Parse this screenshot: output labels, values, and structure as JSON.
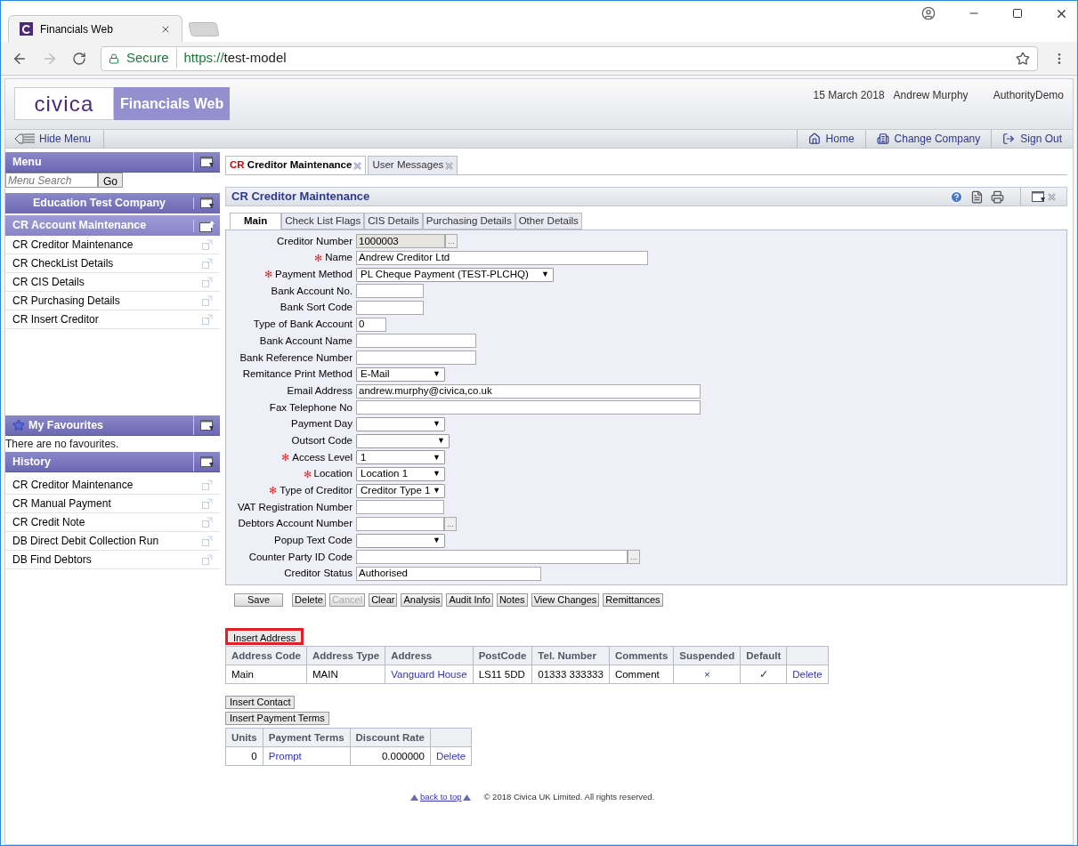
{
  "browser": {
    "tab_title": "Financials Web",
    "security": "Secure",
    "url_scheme": "https://",
    "url_host": "test-model"
  },
  "header": {
    "logo": "civica",
    "product": "Financials Web",
    "date": "15 March 2018",
    "user": "Andrew Murphy",
    "authority": "AuthorityDemo"
  },
  "menu_bar": {
    "hide_menu": "Hide Menu",
    "links": [
      "Home",
      "Change Company",
      "Sign Out"
    ]
  },
  "sidebar": {
    "menu_title": "Menu",
    "search_placeholder": "Menu Search",
    "go": "Go",
    "company": "Education Test Company",
    "section": "CR Account Maintenance",
    "items": [
      "CR Creditor Maintenance",
      "CR CheckList Details",
      "CR CIS Details",
      "CR Purchasing Details",
      "CR Insert Creditor"
    ],
    "favourites_title": "My Favourites",
    "favourites_empty": "There are no favourites.",
    "history_title": "History",
    "history": [
      "CR Creditor Maintenance",
      "CR Manual Payment",
      "CR Credit Note",
      "DB Direct Debit Collection Run",
      "DB Find Debtors"
    ]
  },
  "page_tabs": [
    {
      "prefix": "CR",
      "label": "Creditor Maintenance",
      "selected": true
    },
    {
      "label": "User Messages",
      "selected": false
    }
  ],
  "panel_title": "CR Creditor Maintenance",
  "form_tabs": [
    {
      "label": "Main",
      "selected": true
    },
    {
      "label": "Check List Flags",
      "selected": false
    },
    {
      "label": "CIS Details",
      "selected": false
    },
    {
      "label": "Purchasing Details",
      "selected": false
    },
    {
      "label": "Other Details",
      "selected": false
    }
  ],
  "fields": [
    {
      "label": "Creditor Number",
      "kind": "lookup",
      "required": false,
      "readonly": true,
      "value": "1000003"
    },
    {
      "label": "Name",
      "kind": "text",
      "required": true,
      "readonly": false,
      "value": "Andrew Creditor Ltd"
    },
    {
      "label": "Payment Method",
      "kind": "select",
      "required": true,
      "readonly": false,
      "value": "PL Cheque Payment (TEST-PLCHQ)"
    },
    {
      "label": "Bank Account No.",
      "kind": "text",
      "required": false,
      "readonly": false
    },
    {
      "label": "Bank Sort Code",
      "kind": "text",
      "required": false,
      "readonly": false
    },
    {
      "label": "Type of Bank Account",
      "kind": "text",
      "required": false,
      "readonly": false,
      "value": "0"
    },
    {
      "label": "Bank Account Name",
      "kind": "text",
      "required": false,
      "readonly": false
    },
    {
      "label": "Bank Reference Number",
      "kind": "text",
      "required": false,
      "readonly": false
    },
    {
      "label": "Remitance Print Method",
      "kind": "select",
      "required": false,
      "readonly": false,
      "value": "E-Mail"
    },
    {
      "label": "Email Address",
      "kind": "text",
      "required": false,
      "readonly": false,
      "value": "andrew.murphy@civica,co.uk"
    },
    {
      "label": "Fax Telephone No",
      "kind": "text",
      "required": false,
      "readonly": false
    },
    {
      "label": "Payment Day",
      "kind": "select",
      "required": false,
      "readonly": false
    },
    {
      "label": "Outsort Code",
      "kind": "select",
      "required": false,
      "readonly": false
    },
    {
      "label": "Access Level",
      "kind": "select",
      "required": true,
      "readonly": false,
      "value": "1"
    },
    {
      "label": "Location",
      "kind": "select",
      "required": true,
      "readonly": false,
      "value": "Location 1"
    },
    {
      "label": "Type of Creditor",
      "kind": "select",
      "required": true,
      "readonly": false,
      "value": "Creditor Type 1"
    },
    {
      "label": "VAT Registration Number",
      "kind": "text",
      "required": false,
      "readonly": false
    },
    {
      "label": "Debtors Account Number",
      "kind": "lookup",
      "required": false,
      "readonly": false
    },
    {
      "label": "Popup Text Code",
      "kind": "select",
      "required": false,
      "readonly": false
    },
    {
      "label": "Counter Party ID Code",
      "kind": "lookup",
      "required": false,
      "readonly": false
    },
    {
      "label": "Creditor Status",
      "kind": "text",
      "required": false,
      "readonly": false,
      "value": "Authorised"
    }
  ],
  "lookup_button": "...",
  "required_mark": "✻",
  "dropdown_caret": "▼",
  "actions": [
    {
      "label": "Save",
      "disabled": false
    },
    {
      "label": "Delete",
      "disabled": false
    },
    {
      "label": "Cancel",
      "disabled": true
    },
    {
      "label": "Clear",
      "disabled": false
    },
    {
      "label": "Analysis",
      "disabled": false
    },
    {
      "label": "Audit Info",
      "disabled": false
    },
    {
      "label": "Notes",
      "disabled": false
    },
    {
      "label": "View Changes",
      "disabled": false
    },
    {
      "label": "Remittances",
      "disabled": false
    }
  ],
  "insert_address": {
    "label": "Insert Address",
    "highlighted": true
  },
  "address_table": {
    "columns": [
      "Address Code",
      "Address Type",
      "Address",
      "PostCode",
      "Tel. Number",
      "Comments",
      "Suspended",
      "Default"
    ],
    "rows": [
      [
        "Main",
        "MAIN",
        "Vanguard House",
        "LS11 5DD",
        "01333 333333",
        "Comment",
        "×",
        "✓",
        "Delete"
      ]
    ]
  },
  "insert_contact": "Insert Contact",
  "insert_payment_terms": "Insert Payment Terms",
  "terms_table": {
    "columns": [
      "Units",
      "Payment Terms",
      "Discount Rate"
    ],
    "rows": [
      [
        "0",
        "Prompt",
        "0.000000",
        "Delete"
      ]
    ]
  },
  "footer": {
    "back_to_top": "back to top",
    "copyright": "© 2018 Civica UK Limited. All rights reserved."
  }
}
